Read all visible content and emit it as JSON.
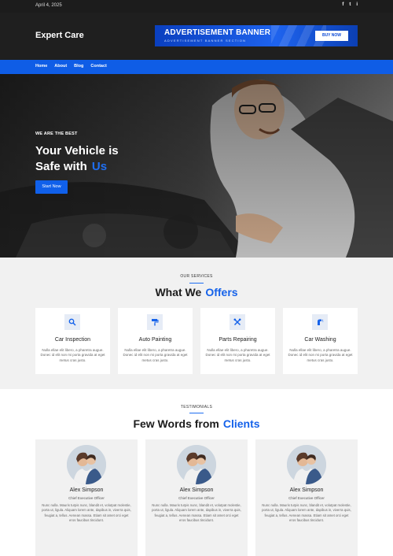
{
  "topbar": {
    "date": "April 4, 2025",
    "social": [
      "f",
      "t",
      "i"
    ]
  },
  "header": {
    "logo": "Expert Care",
    "ad": {
      "title": "ADVERTISEMENT BANNER",
      "subtitle": "ADVERTISEMENT BANNER SECTION",
      "button": "BUY NOW"
    }
  },
  "nav": {
    "items": [
      "Home",
      "About",
      "Blog",
      "Contact"
    ]
  },
  "hero": {
    "kicker": "WE ARE THE BEST",
    "title_line1": "Your Vehicle is",
    "title_line2": "Safe with",
    "title_accent": "Us",
    "button": "Start Now"
  },
  "services": {
    "kicker": "OUR SERVICES",
    "title": "What We",
    "title_accent": "Offers",
    "cards": [
      {
        "icon": "search-icon",
        "name": "Car Inspection",
        "desc": "Nulla ellae elit libero, a pharetra augue. Donec id elit non mi porta gravida at eget metus cras justo."
      },
      {
        "icon": "paint-roller-icon",
        "name": "Auto Painting",
        "desc": "Nulla ellae elit libero, a pharetra augue. Donec id elit non mi porta gravida at eget metus cras justo."
      },
      {
        "icon": "tools-icon",
        "name": "Parts Repairing",
        "desc": "Nulla ellae elit libero, a pharetra augue. Donec id elit non mi porta gravida at eget metus cras justo."
      },
      {
        "icon": "spray-icon",
        "name": "Car Washing",
        "desc": "Nulla ellae elit libero, a pharetra augue. Donec id elit non mi porta gravida at eget metus cras justo."
      }
    ]
  },
  "testimonials": {
    "kicker": "TESTIMONIALS",
    "title": "Few Words from",
    "title_accent": "Clients",
    "items": [
      {
        "name": "Alex Simpson",
        "role": "Chief Executive Officer",
        "quote": "Nunc nulla. Mauris turpis nunc, blandit et, volutpat molestie, porta ut, ligula. Aliquam lorem ante, dapibus in, viverra quis, feugiat a, tellus. Aenean massa. Etiam sit amet orci eget eros faucibus tincidunt."
      },
      {
        "name": "Alex Simpson",
        "role": "Chief Executive Officer",
        "quote": "Nunc nulla. Mauris turpis nunc, blandit et, volutpat molestie, porta ut, ligula. Aliquam lorem ante, dapibus in, viverra quis, feugiat a, tellus. Aenean massa. Etiam sit amet orci eget eros faucibus tincidunt."
      },
      {
        "name": "Alex Simpson",
        "role": "Chief Executive Officer",
        "quote": "Nunc nulla. Mauris turpis nunc, blandit et, volutpat molestie, porta ut, ligula. Aliquam lorem ante, dapibus in, viverra quis, feugiat a, tellus. Aenean massa. Etiam sit amet orci eget eros faucibus tincidunt."
      }
    ]
  },
  "colors": {
    "accent": "#1060ea",
    "dark": "#1f1f1f",
    "section_bg": "#f1f1f1"
  }
}
